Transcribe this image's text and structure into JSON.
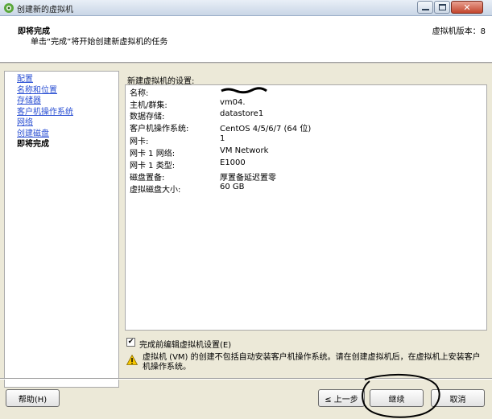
{
  "window": {
    "title": "创建新的虚拟机"
  },
  "header": {
    "title": "即将完成",
    "subtitle": "单击“完成”将开始创建新虚拟机的任务",
    "version": "虚拟机版本：8"
  },
  "nav": {
    "items": [
      {
        "label": "配置",
        "current": false
      },
      {
        "label": "名称和位置",
        "current": false
      },
      {
        "label": "存储器",
        "current": false
      },
      {
        "label": "客户机操作系统",
        "current": false
      },
      {
        "label": "网络",
        "current": false
      },
      {
        "label": "创建磁盘",
        "current": false
      },
      {
        "label": "即将完成",
        "current": true
      }
    ]
  },
  "settings": {
    "title": "新建虚拟机的设置:",
    "rows": [
      {
        "key": "名称:",
        "value": ""
      },
      {
        "key": "主机/群集:",
        "value": "vm04."
      },
      {
        "key": "数据存储:",
        "value": "datastore1"
      },
      {
        "key": "客户机操作系统:",
        "value": "CentOS 4/5/6/7 (64 位)"
      },
      {
        "key": "网卡:",
        "value": "1"
      },
      {
        "key": "网卡 1 网络:",
        "value": "VM Network"
      },
      {
        "key": "网卡 1 类型:",
        "value": "E1000"
      },
      {
        "key": "磁盘置备:",
        "value": "厚置备延迟置零"
      },
      {
        "key": "虚拟磁盘大小:",
        "value": "60 GB"
      }
    ]
  },
  "edit_checkbox": {
    "label": "完成前编辑虚拟机设置(E)",
    "checked": true
  },
  "warning": {
    "text": "虚拟机 (VM) 的创建不包括自动安装客户机操作系统。请在创建虚拟机后，在虚拟机上安装客户机操作系统。"
  },
  "buttons": {
    "help": "帮助(H)",
    "back": "≤ 上一步",
    "next": "继续",
    "cancel": "取消"
  },
  "colors": {
    "link": "#2a4fd3",
    "window_bg": "#ece9d8",
    "annotation": "#000000"
  }
}
